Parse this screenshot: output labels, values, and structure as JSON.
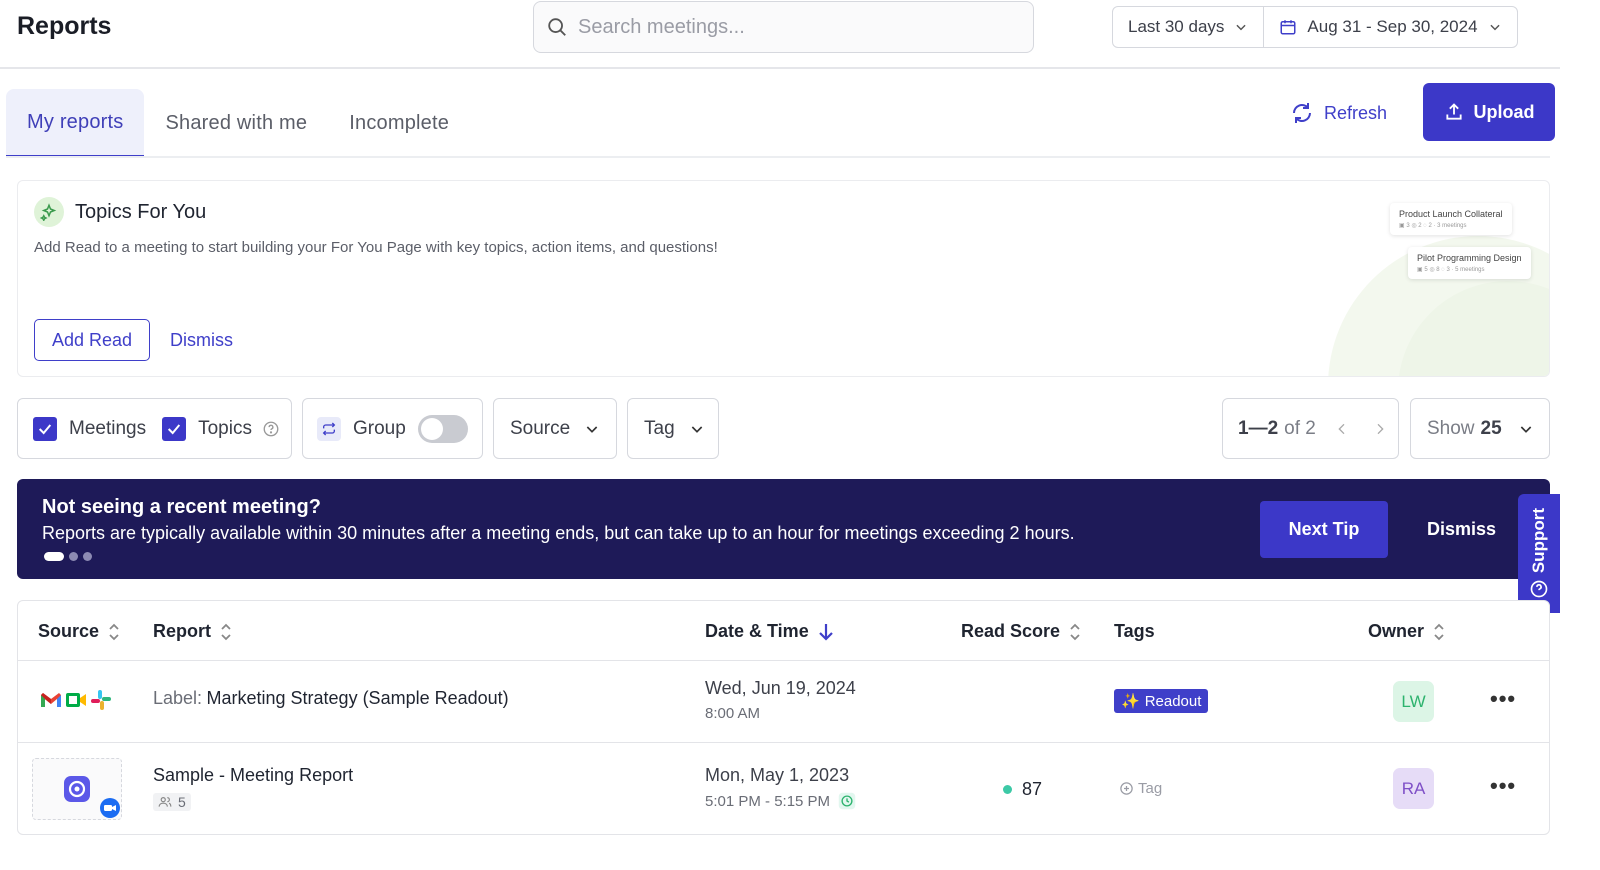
{
  "header": {
    "title": "Reports",
    "search_placeholder": "Search meetings...",
    "range_label": "Last 30 days",
    "date_range": "Aug 31 - Sep 30, 2024"
  },
  "tabs": [
    {
      "label": "My reports",
      "active": true
    },
    {
      "label": "Shared with me",
      "active": false
    },
    {
      "label": "Incomplete",
      "active": false
    }
  ],
  "actions": {
    "refresh_label": "Refresh",
    "upload_label": "Upload"
  },
  "topics_card": {
    "title": "Topics For You",
    "description": "Add Read to a meeting to start building your For You Page with key topics, action items, and questions!",
    "add_read_label": "Add Read",
    "dismiss_label": "Dismiss",
    "previews": [
      {
        "title": "Product Launch Collateral",
        "meta": "▣ 3  ◎ 2  ◌ 2  ·  3 meetings"
      },
      {
        "title": "Pilot Programming Design",
        "meta": "▣ 5  ◎ 8  ◌ 3  ·  5 meetings"
      }
    ]
  },
  "filters": {
    "meetings_label": "Meetings",
    "meetings_checked": true,
    "topics_label": "Topics",
    "topics_checked": true,
    "group_label": "Group",
    "group_on": false,
    "source_label": "Source",
    "tag_label": "Tag",
    "pagination_range": "1—2",
    "pagination_total": "of 2",
    "show_label": "Show",
    "show_value": "25"
  },
  "banner": {
    "title": "Not seeing a recent meeting?",
    "text": "Reports are typically available within 30 minutes after a meeting ends, but can take up to an hour for meetings exceeding 2 hours.",
    "next_tip_label": "Next Tip",
    "dismiss_label": "Dismiss"
  },
  "support_label": "Support",
  "table": {
    "columns": {
      "source": "Source",
      "report": "Report",
      "datetime": "Date & Time",
      "read_score": "Read Score",
      "tags": "Tags",
      "owner": "Owner"
    },
    "rows": [
      {
        "label_prefix": "Label:",
        "name": "Marketing Strategy (Sample Readout)",
        "date": "Wed, Jun 19, 2024",
        "time": "8:00 AM",
        "score": "",
        "tag": "Readout",
        "owner": "LW"
      },
      {
        "label_prefix": "",
        "name": "Sample - Meeting Report",
        "participants": "5",
        "date": "Mon, May 1, 2023",
        "time": "5:01 PM - 5:15 PM",
        "score": "87",
        "tag": "Tag",
        "owner": "RA"
      }
    ]
  },
  "colors": {
    "accent": "#3c38c8",
    "banner": "#1e1a58",
    "score_dot": "#3cc9a6",
    "avatar_lw_bg": "#dcf5e6",
    "avatar_lw_fg": "#2db36e",
    "avatar_ra_bg": "#e6dcf7",
    "avatar_ra_fg": "#7e4fc7"
  }
}
